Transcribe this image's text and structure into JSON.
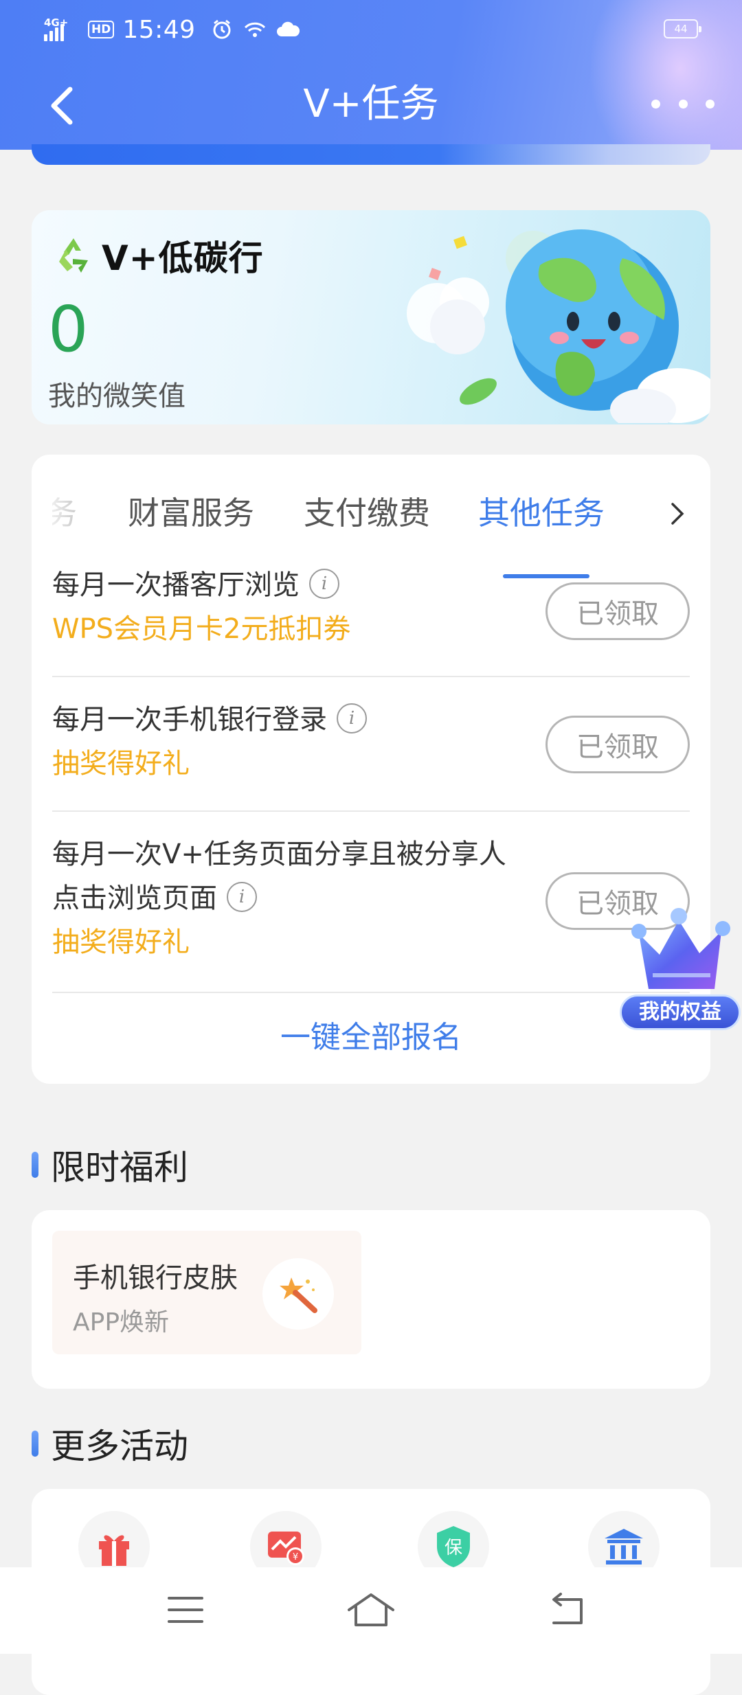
{
  "status_bar": {
    "network": "4G+",
    "hd": "HD",
    "time": "15:49",
    "battery": "44",
    "icons": [
      "alarm-icon",
      "wifi-icon",
      "cloud-icon"
    ]
  },
  "header": {
    "title": "V+任务",
    "back_icon": "chevron-left-icon",
    "more_icon": "more-dots-icon"
  },
  "carbon_card": {
    "title": "V+低碳行",
    "value": "0",
    "label": "我的微笑值",
    "icon": "recycle-icon"
  },
  "tasks": {
    "tabs": [
      {
        "label": "务",
        "active": false
      },
      {
        "label": "财富服务",
        "active": false
      },
      {
        "label": "支付缴费",
        "active": false
      },
      {
        "label": "其他任务",
        "active": true
      }
    ],
    "items": [
      {
        "title": "每月一次播客厅浏览",
        "title_line2": "",
        "reward": "WPS会员月卡2元抵扣券",
        "button": "已领取"
      },
      {
        "title": "每月一次手机银行登录",
        "title_line2": "",
        "reward": "抽奖得好礼",
        "button": "已领取"
      },
      {
        "title": "每月一次V+任务页面分享且被分享人",
        "title_line2": "点击浏览页面",
        "reward": "抽奖得好礼",
        "button": "已领取"
      }
    ],
    "register_all": "一键全部报名"
  },
  "floating_badge": {
    "label": "我的权益"
  },
  "welfare": {
    "section_title": "限时福利",
    "item": {
      "title": "手机银行皮肤",
      "subtitle": "APP焕新"
    }
  },
  "activities": {
    "section_title": "更多活动",
    "icons": [
      "gift-icon",
      "finance-chart-icon",
      "insurance-shield-icon",
      "bank-icon"
    ],
    "shield_char": "保"
  },
  "colors": {
    "accent": "#3f7de9",
    "reward": "#f3ad1c",
    "green": "#2aa456"
  }
}
